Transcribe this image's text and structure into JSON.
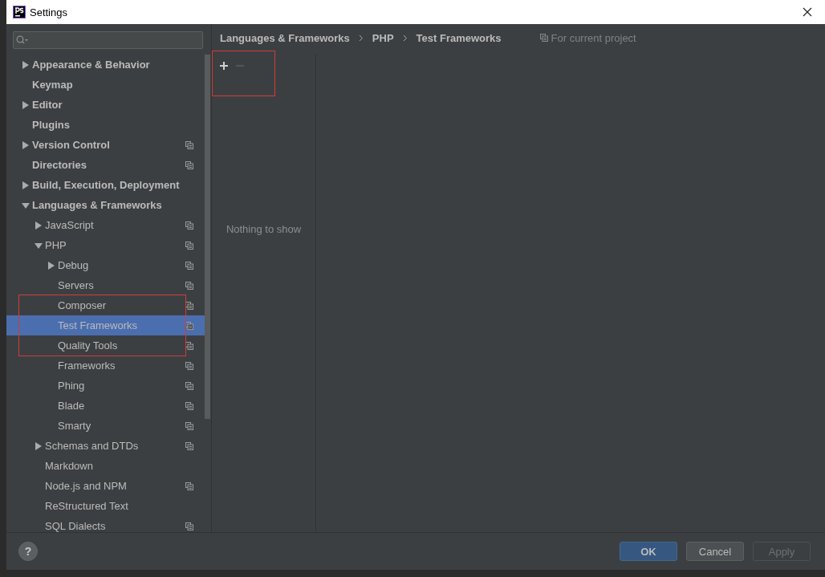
{
  "window": {
    "title": "Settings"
  },
  "tree": [
    {
      "label": "Appearance & Behavior",
      "expanded": false,
      "selected": false,
      "project_scope": false,
      "highlighted": false
    },
    {
      "label": "Keymap",
      "selected": false,
      "project_scope": false,
      "highlighted": false
    },
    {
      "label": "Editor",
      "expanded": false,
      "selected": false,
      "project_scope": false,
      "highlighted": false
    },
    {
      "label": "Plugins",
      "selected": false,
      "project_scope": false,
      "highlighted": false
    },
    {
      "label": "Version Control",
      "expanded": false,
      "selected": false,
      "project_scope": true,
      "highlighted": false
    },
    {
      "label": "Directories",
      "selected": false,
      "project_scope": true,
      "highlighted": false
    },
    {
      "label": "Build, Execution, Deployment",
      "expanded": false,
      "selected": false,
      "project_scope": false,
      "highlighted": false
    },
    {
      "label": "Languages & Frameworks",
      "expanded": true,
      "selected": false,
      "project_scope": false,
      "highlighted": false,
      "children": [
        {
          "label": "JavaScript",
          "expanded": false,
          "selected": false,
          "project_scope": true,
          "highlighted": false
        },
        {
          "label": "PHP",
          "expanded": true,
          "selected": false,
          "project_scope": true,
          "highlighted": false,
          "children": [
            {
              "label": "Debug",
              "expanded": false,
              "selected": false,
              "project_scope": true,
              "highlighted": false
            },
            {
              "label": "Servers",
              "selected": false,
              "project_scope": true,
              "highlighted": false
            },
            {
              "label": "Composer",
              "selected": false,
              "project_scope": true,
              "highlighted": true
            },
            {
              "label": "Test Frameworks",
              "selected": true,
              "project_scope": true,
              "highlighted": true
            },
            {
              "label": "Quality Tools",
              "selected": false,
              "project_scope": true,
              "highlighted": true
            },
            {
              "label": "Frameworks",
              "selected": false,
              "project_scope": true,
              "highlighted": false
            },
            {
              "label": "Phing",
              "selected": false,
              "project_scope": true,
              "highlighted": false
            },
            {
              "label": "Blade",
              "selected": false,
              "project_scope": true,
              "highlighted": false
            },
            {
              "label": "Smarty",
              "selected": false,
              "project_scope": true,
              "highlighted": false
            }
          ]
        },
        {
          "label": "Schemas and DTDs",
          "expanded": false,
          "selected": false,
          "project_scope": true,
          "highlighted": false
        },
        {
          "label": "Markdown",
          "selected": false,
          "project_scope": false,
          "highlighted": false
        },
        {
          "label": "Node.js and NPM",
          "selected": false,
          "project_scope": true,
          "highlighted": false
        },
        {
          "label": "ReStructured Text",
          "selected": false,
          "project_scope": false,
          "highlighted": false
        },
        {
          "label": "SQL Dialects",
          "selected": false,
          "project_scope": true,
          "highlighted": false
        }
      ]
    }
  ],
  "breadcrumb": [
    "Languages & Frameworks",
    "PHP",
    "Test Frameworks"
  ],
  "scope_note": "For current project",
  "toolbar": {
    "highlighted": true,
    "buttons": [
      {
        "kind": "add",
        "disabled": false
      },
      {
        "kind": "remove",
        "disabled": true
      }
    ]
  },
  "empty_text": "Nothing to show",
  "buttons": [
    {
      "label": "OK",
      "kind": "primary",
      "disabled": false
    },
    {
      "label": "Cancel",
      "kind": "normal",
      "disabled": false
    },
    {
      "label": "Apply",
      "kind": "normal",
      "disabled": true
    }
  ],
  "help": {
    "label": "?"
  }
}
